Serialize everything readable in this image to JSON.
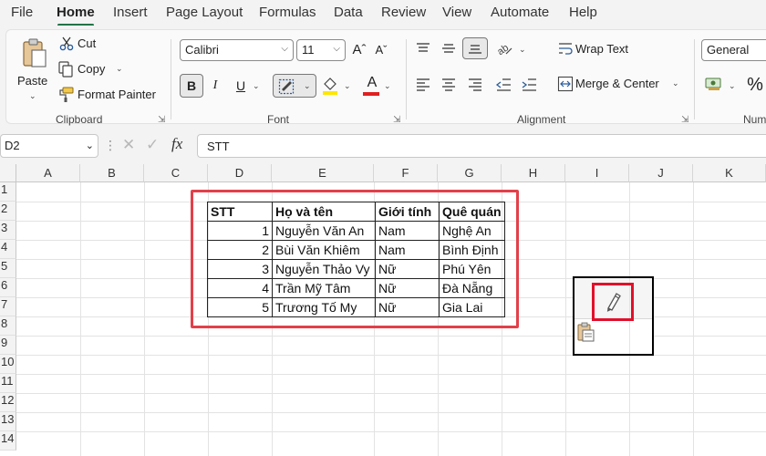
{
  "menu": {
    "items": [
      "File",
      "Home",
      "Insert",
      "Page Layout",
      "Formulas",
      "Data",
      "Review",
      "View",
      "Automate",
      "Help"
    ],
    "active": "Home"
  },
  "ribbon": {
    "clipboard": {
      "paste_label": "Paste",
      "cut_label": "Cut",
      "copy_label": "Copy",
      "format_painter_label": "Format Painter",
      "group_label": "Clipboard"
    },
    "font": {
      "font_name": "Calibri",
      "font_size": "11",
      "bold": "B",
      "italic": "I",
      "underline": "U",
      "group_label": "Font"
    },
    "alignment": {
      "wrap_text_label": "Wrap Text",
      "merge_center_label": "Merge & Center",
      "group_label": "Alignment"
    },
    "number": {
      "format_value": "General",
      "percent": "%",
      "group_label": "Num"
    }
  },
  "formula_bar": {
    "name_box": "D2",
    "fx": "fx",
    "content": "STT"
  },
  "sheet": {
    "columns": [
      "A",
      "B",
      "C",
      "D",
      "E",
      "F",
      "G",
      "H",
      "I",
      "J",
      "K"
    ],
    "rows": [
      "1",
      "2",
      "3",
      "4",
      "5",
      "6",
      "7",
      "8",
      "9",
      "10",
      "11",
      "12",
      "13",
      "14"
    ]
  },
  "table": {
    "headers": [
      "STT",
      "Họ và tên",
      "Giới tính",
      "Quê quán"
    ],
    "rows": [
      [
        "1",
        "Nguyễn Văn An",
        "Nam",
        "Nghệ An"
      ],
      [
        "2",
        "Bùi Văn Khiêm",
        "Nam",
        "Bình Định"
      ],
      [
        "3",
        "Nguyễn Thảo Vy",
        "Nữ",
        "Phú Yên"
      ],
      [
        "4",
        "Trần Mỹ Tâm",
        "Nữ",
        "Đà Nẵng"
      ],
      [
        "5",
        "Trương Tố My",
        "Nữ",
        "Gia Lai"
      ]
    ]
  },
  "colors": {
    "accent": "#217346",
    "highlight_box": "#e2404a"
  },
  "icons": [
    "paste-icon",
    "cut-icon",
    "copy-icon",
    "format-painter-icon",
    "pencil-icon",
    "paste-options-icon"
  ]
}
